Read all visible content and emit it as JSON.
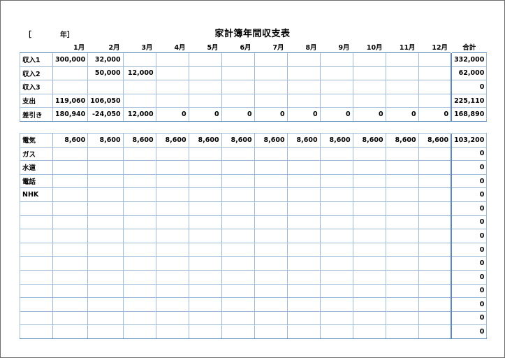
{
  "document": {
    "title": "家計簿年間収支表",
    "year_open": "［",
    "year_suffix": "年］"
  },
  "table": {
    "months": [
      "1月",
      "2月",
      "3月",
      "4月",
      "5月",
      "6月",
      "7月",
      "8月",
      "9月",
      "10月",
      "11月",
      "12月"
    ],
    "total_label": "合計",
    "income_rows": [
      {
        "label": "収入1",
        "values": [
          "300,000",
          "32,000",
          "",
          "",
          "",
          "",
          "",
          "",
          "",
          "",
          "",
          ""
        ],
        "total": "332,000"
      },
      {
        "label": "収入2",
        "values": [
          "",
          "50,000",
          "12,000",
          "",
          "",
          "",
          "",
          "",
          "",
          "",
          "",
          ""
        ],
        "total": "62,000"
      },
      {
        "label": "収入3",
        "values": [
          "",
          "",
          "",
          "",
          "",
          "",
          "",
          "",
          "",
          "",
          "",
          ""
        ],
        "total": "0"
      },
      {
        "label": "支出",
        "values": [
          "119,060",
          "106,050",
          "",
          "",
          "",
          "",
          "",
          "",
          "",
          "",
          "",
          ""
        ],
        "total": "225,110"
      },
      {
        "label": "差引き",
        "values": [
          "180,940",
          "-24,050",
          "12,000",
          "0",
          "0",
          "0",
          "0",
          "0",
          "0",
          "0",
          "0",
          "0"
        ],
        "total": "168,890"
      }
    ],
    "expense_rows": [
      {
        "label": "電気",
        "values": [
          "8,600",
          "8,600",
          "8,600",
          "8,600",
          "8,600",
          "8,600",
          "8,600",
          "8,600",
          "8,600",
          "8,600",
          "8,600",
          "8,600"
        ],
        "total": "103,200"
      },
      {
        "label": "ガス",
        "values": [
          "",
          "",
          "",
          "",
          "",
          "",
          "",
          "",
          "",
          "",
          "",
          ""
        ],
        "total": "0"
      },
      {
        "label": "水道",
        "values": [
          "",
          "",
          "",
          "",
          "",
          "",
          "",
          "",
          "",
          "",
          "",
          ""
        ],
        "total": "0"
      },
      {
        "label": "電話",
        "values": [
          "",
          "",
          "",
          "",
          "",
          "",
          "",
          "",
          "",
          "",
          "",
          ""
        ],
        "total": "0"
      },
      {
        "label": "NHK",
        "values": [
          "",
          "",
          "",
          "",
          "",
          "",
          "",
          "",
          "",
          "",
          "",
          ""
        ],
        "total": "0"
      },
      {
        "label": "",
        "values": [
          "",
          "",
          "",
          "",
          "",
          "",
          "",
          "",
          "",
          "",
          "",
          ""
        ],
        "total": "0"
      },
      {
        "label": "",
        "values": [
          "",
          "",
          "",
          "",
          "",
          "",
          "",
          "",
          "",
          "",
          "",
          ""
        ],
        "total": "0"
      },
      {
        "label": "",
        "values": [
          "",
          "",
          "",
          "",
          "",
          "",
          "",
          "",
          "",
          "",
          "",
          ""
        ],
        "total": "0"
      },
      {
        "label": "",
        "values": [
          "",
          "",
          "",
          "",
          "",
          "",
          "",
          "",
          "",
          "",
          "",
          ""
        ],
        "total": "0"
      },
      {
        "label": "",
        "values": [
          "",
          "",
          "",
          "",
          "",
          "",
          "",
          "",
          "",
          "",
          "",
          ""
        ],
        "total": "0"
      },
      {
        "label": "",
        "values": [
          "",
          "",
          "",
          "",
          "",
          "",
          "",
          "",
          "",
          "",
          "",
          ""
        ],
        "total": "0"
      },
      {
        "label": "",
        "values": [
          "",
          "",
          "",
          "",
          "",
          "",
          "",
          "",
          "",
          "",
          "",
          ""
        ],
        "total": "0"
      },
      {
        "label": "",
        "values": [
          "",
          "",
          "",
          "",
          "",
          "",
          "",
          "",
          "",
          "",
          "",
          ""
        ],
        "total": "0"
      },
      {
        "label": "",
        "values": [
          "",
          "",
          "",
          "",
          "",
          "",
          "",
          "",
          "",
          "",
          "",
          ""
        ],
        "total": "0"
      },
      {
        "label": "",
        "values": [
          "",
          "",
          "",
          "",
          "",
          "",
          "",
          "",
          "",
          "",
          "",
          ""
        ],
        "total": "0"
      }
    ]
  },
  "colors": {
    "grid_line": "#9dbbd8",
    "strong_line": "#4a7fb8",
    "frame": "#6b6b6b"
  }
}
